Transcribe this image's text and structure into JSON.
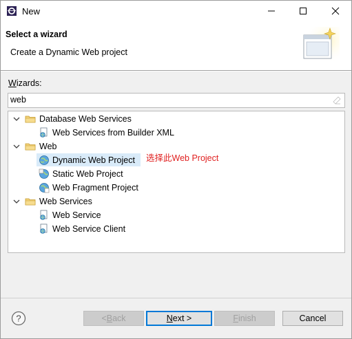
{
  "window": {
    "title": "New",
    "minimize_glyph": "—",
    "maximize_glyph": "☐",
    "close_glyph": "✕"
  },
  "banner": {
    "title": "Select a wizard",
    "description": "Create a Dynamic Web project"
  },
  "wizards": {
    "label_prefix": "W",
    "label_rest": "izards:",
    "filter_value": "web"
  },
  "tree": {
    "groups": [
      {
        "label": "Database Web Services",
        "items": [
          "Web Services from Builder XML"
        ]
      },
      {
        "label": "Web",
        "items": [
          "Dynamic Web Project",
          "Static Web Project",
          "Web Fragment Project"
        ]
      },
      {
        "label": "Web Services",
        "items": [
          "Web Service",
          "Web Service Client"
        ]
      }
    ],
    "selected": "Dynamic Web Project"
  },
  "annotation": "选择此Web Project",
  "buttons": {
    "back_prefix": "< ",
    "back_mnemonic": "B",
    "back_rest": "ack",
    "next_mnemonic": "N",
    "next_rest": "ext >",
    "finish_mnemonic": "F",
    "finish_rest": "inish",
    "cancel": "Cancel"
  },
  "colors": {
    "annotation": "#e02020",
    "selection": "#d9ebf9",
    "folder": "#e8c25a"
  }
}
